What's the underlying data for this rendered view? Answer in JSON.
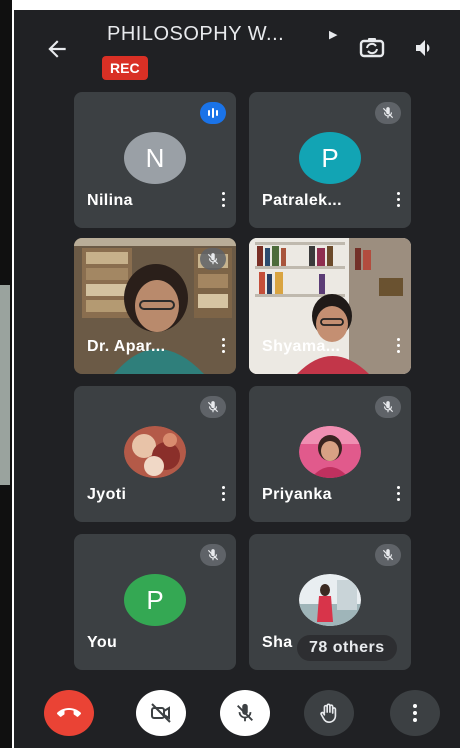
{
  "meeting": {
    "title": "PHILOSOPHY W...",
    "rec_label": "REC"
  },
  "participants": [
    {
      "name": "Nilina",
      "initial": "N",
      "avatar_color": "#9aa0a6",
      "status": "speaking"
    },
    {
      "name": "Patralek...",
      "initial": "P",
      "avatar_color": "#12a4b4",
      "status": "muted"
    },
    {
      "name": "Dr. Apar...",
      "status": "muted",
      "video": true
    },
    {
      "name": "Shyama...",
      "video": true
    },
    {
      "name": "Jyoti",
      "status": "muted",
      "avatar": "photo"
    },
    {
      "name": "Priyanka",
      "status": "muted",
      "avatar": "photo"
    },
    {
      "name": "You",
      "initial": "P",
      "avatar_color": "#34a853",
      "status": "muted"
    },
    {
      "name": "Sha",
      "status": "muted",
      "avatar": "photo"
    }
  ],
  "others": {
    "label": "78 others"
  },
  "icons": {
    "back": "arrow-back-icon",
    "switch_camera": "switch-camera-icon",
    "speaker": "speaker-icon",
    "end_call": "end-call-icon",
    "camera_off": "camera-off-icon",
    "mic_off": "mic-off-icon",
    "raise_hand": "hand-icon",
    "more": "more-vert-icon"
  },
  "colors": {
    "background": "#202124",
    "tile": "#3c4043",
    "rec": "#d93025",
    "end_call": "#ea4335",
    "speaking": "#1a73e8"
  }
}
